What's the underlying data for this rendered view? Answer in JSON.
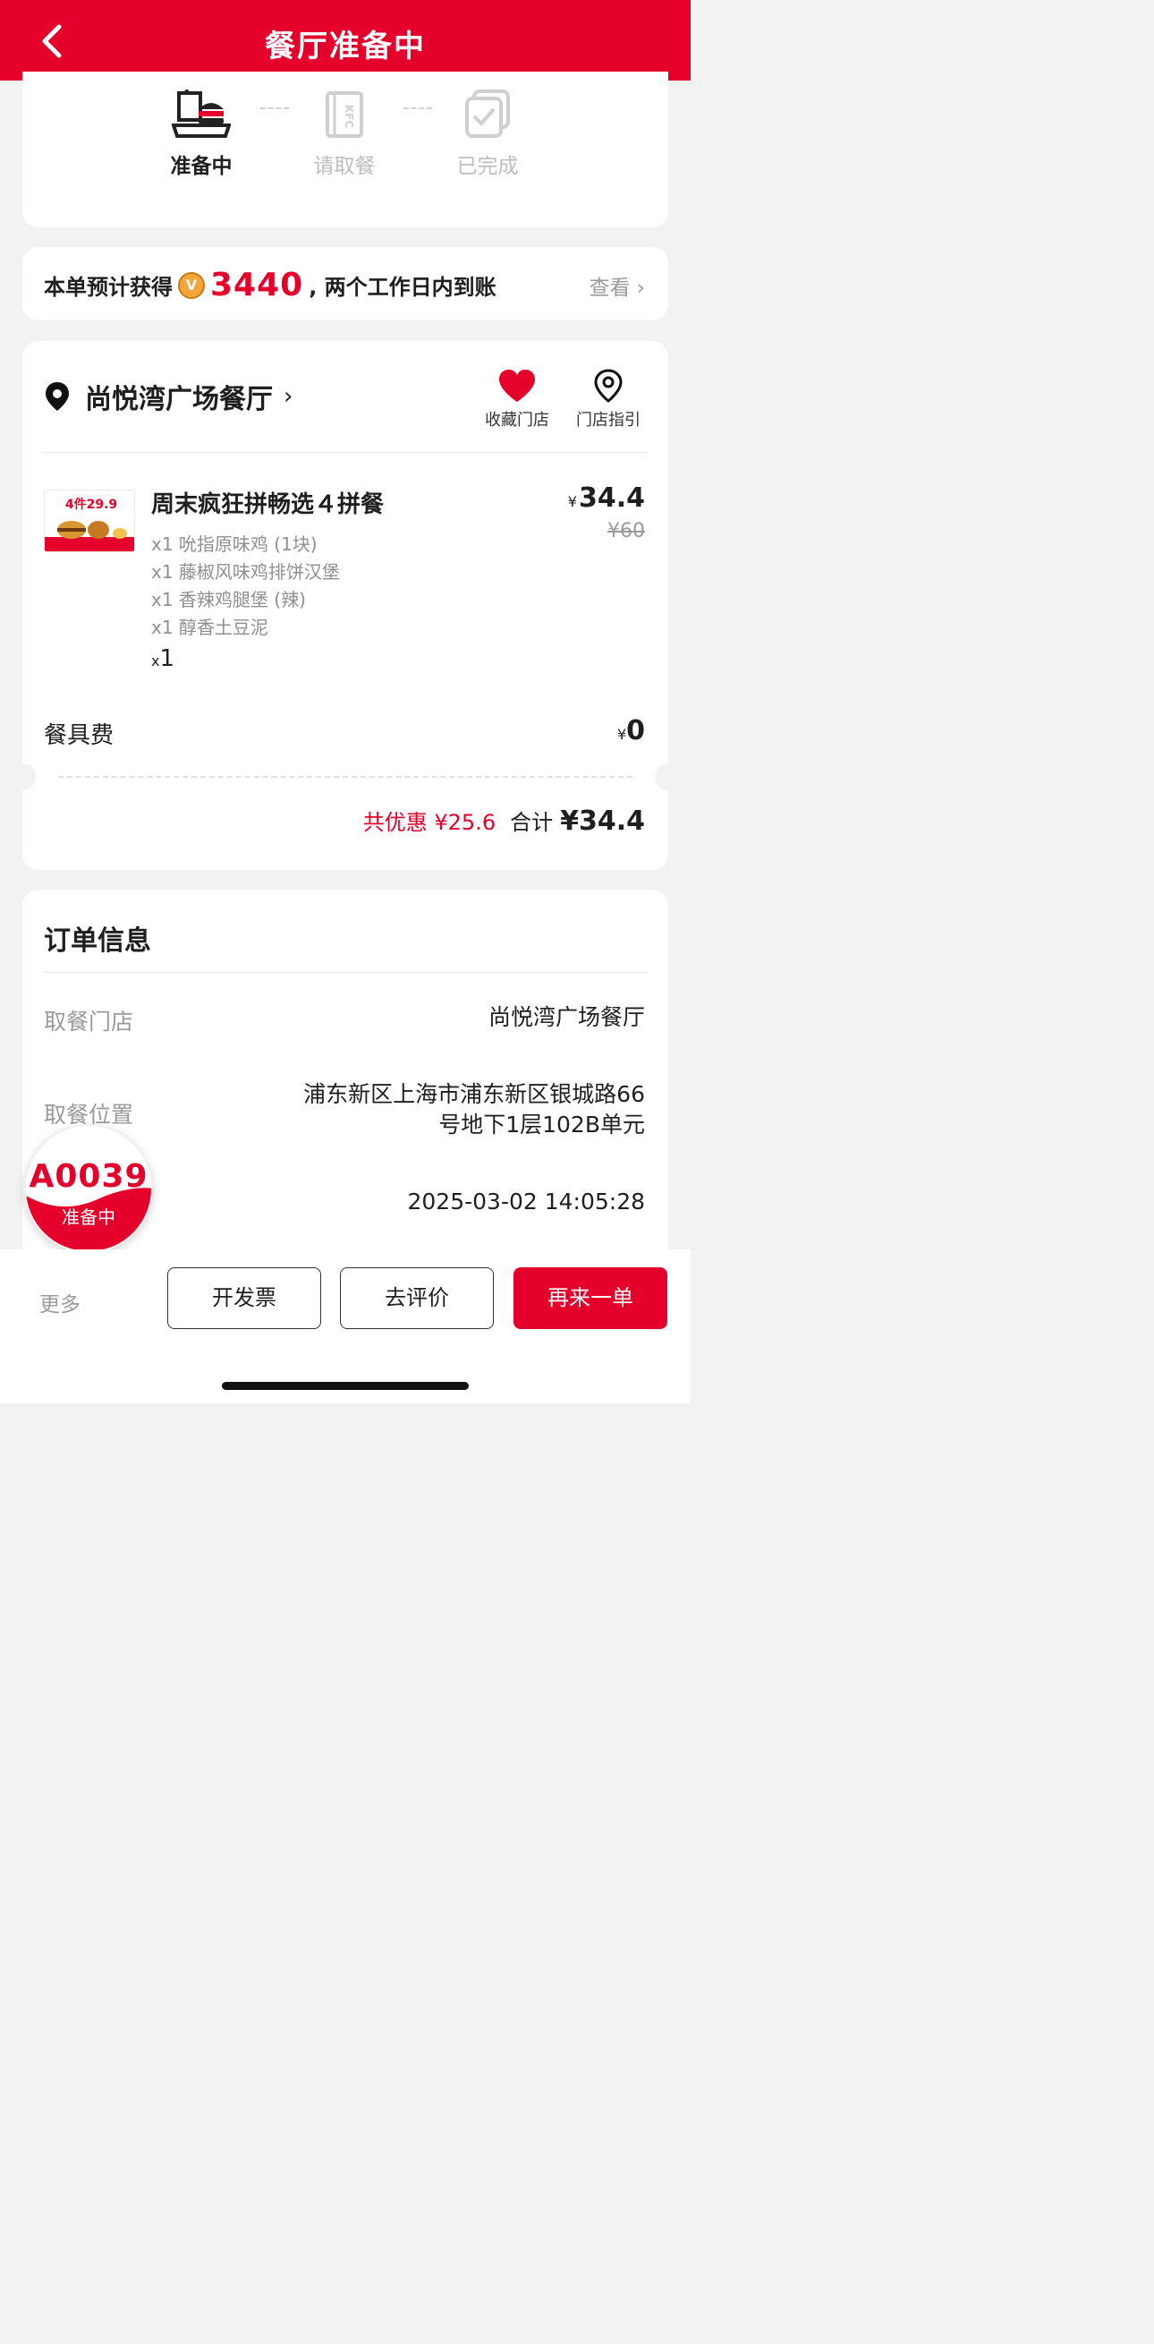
{
  "header": {
    "title": "餐厅准备中"
  },
  "progress": {
    "steps": [
      {
        "label": "准备中"
      },
      {
        "label": "请取餐"
      },
      {
        "label": "已完成"
      }
    ]
  },
  "points": {
    "prefix": "本单预计获得",
    "coin_symbol": "V",
    "amount": "3440",
    "suffix": ", 两个工作日内到账",
    "view_label": "查看",
    "view_chevron": "›"
  },
  "order": {
    "store_name": "尚悦湾广场餐厅",
    "store_chevron": "›",
    "favorite_label": "收藏门店",
    "guide_label": "门店指引",
    "product": {
      "image_badge": "4件29.9",
      "name": "周末疯狂拼畅选４拼餐",
      "items": [
        "x1 吮指原味鸡 (1块)",
        "x1 藤椒风味鸡排饼汉堡",
        "x1 香辣鸡腿堡 (辣)",
        "x1 醇香土豆泥"
      ],
      "qty_prefix": "x",
      "qty": "1",
      "currency": "¥",
      "price": "34.4",
      "old_price": "¥60"
    },
    "fee_label": "餐具费",
    "fee_currency": "¥",
    "fee_value": "0",
    "discount_text": "共优惠 ¥25.6",
    "total_label": "合计",
    "total_amount": "¥34.4"
  },
  "info": {
    "title": "订单信息",
    "pickup_store_label": "取餐门店",
    "pickup_store_value": "尚悦湾广场餐厅",
    "pickup_location_label": "取餐位置",
    "pickup_location_line1": "浦东新区上海市浦东新区银城路66",
    "pickup_location_line2": "号地下1层102B单元",
    "order_time_value": "2025-03-02 14:05:28"
  },
  "badge": {
    "code": "A0039",
    "status": "准备中"
  },
  "bottom": {
    "more_label": "更多",
    "invoice_label": "开发票",
    "review_label": "去评价",
    "reorder_label": "再来一单"
  },
  "colors": {
    "brand_red": "#e4002b",
    "background": "#f2f2f2",
    "muted_text": "#9a9a9a"
  }
}
